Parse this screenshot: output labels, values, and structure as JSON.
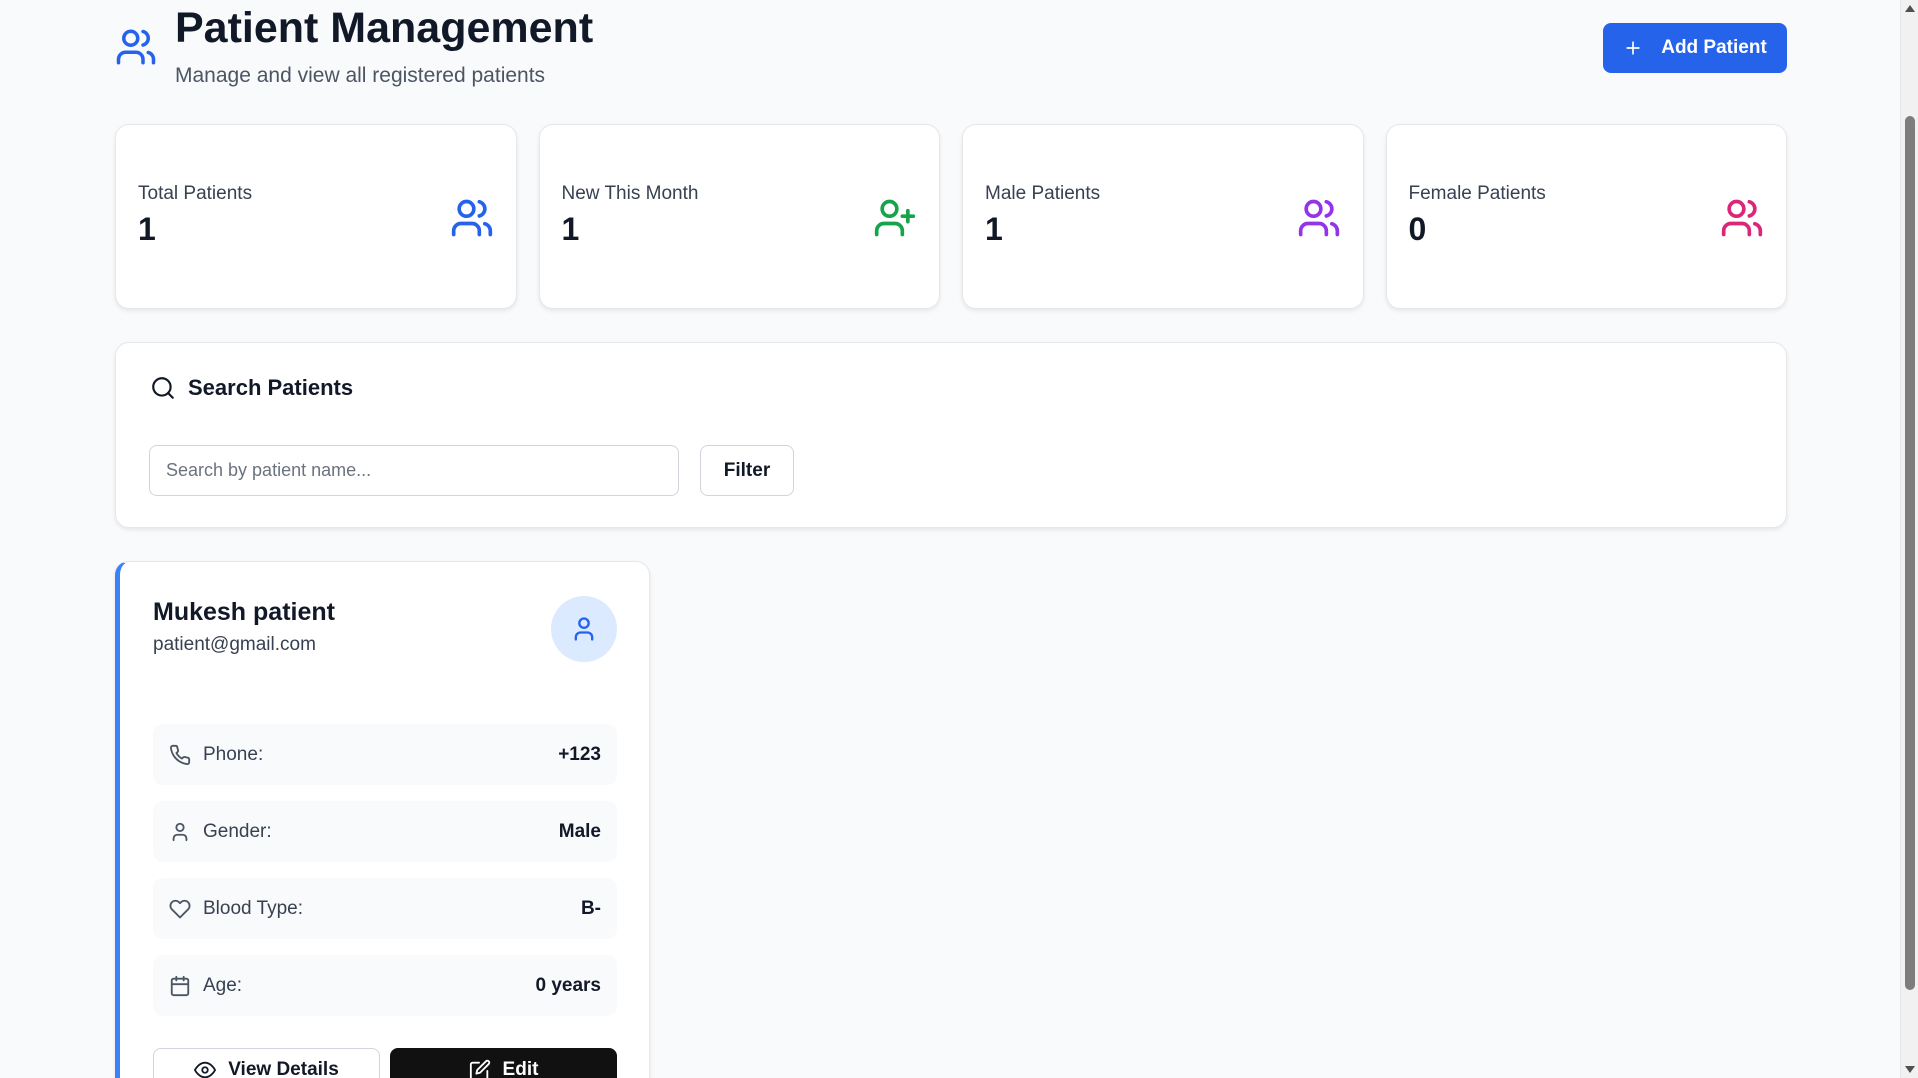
{
  "header": {
    "title": "Patient Management",
    "subtitle": "Manage and view all registered patients",
    "add_button_label": "Add Patient",
    "icon": "users-icon"
  },
  "stats": [
    {
      "label": "Total Patients",
      "value": "1",
      "icon": "users-icon",
      "color": "#2563eb"
    },
    {
      "label": "New This Month",
      "value": "1",
      "icon": "user-plus-icon",
      "color": "#16a34a"
    },
    {
      "label": "Male Patients",
      "value": "1",
      "icon": "users-icon",
      "color": "#9333ea"
    },
    {
      "label": "Female Patients",
      "value": "0",
      "icon": "users-icon",
      "color": "#db2777"
    }
  ],
  "search": {
    "title": "Search Patients",
    "placeholder": "Search by patient name...",
    "value": "",
    "filter_label": "Filter"
  },
  "patients": [
    {
      "name": "Mukesh patient",
      "email": "patient@gmail.com",
      "phone_label": "Phone:",
      "phone": "+123",
      "gender_label": "Gender:",
      "gender": "Male",
      "blood_label": "Blood Type:",
      "blood_type": "B-",
      "age_label": "Age:",
      "age": "0 years",
      "view_label": "View Details",
      "edit_label": "Edit"
    }
  ],
  "colors": {
    "accent": "#2563eb",
    "card_border_accent": "#3b82f6",
    "edit_button": "#111111"
  }
}
